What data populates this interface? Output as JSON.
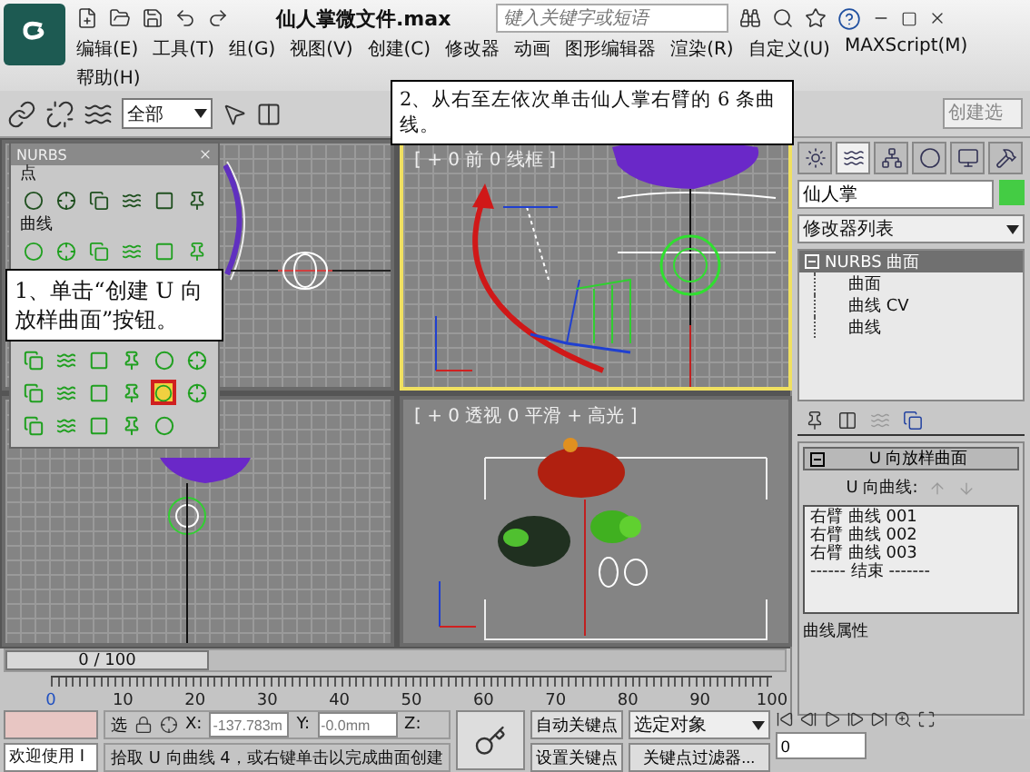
{
  "window": {
    "title": "仙人掌微文件.max",
    "search_placeholder": "键入关键字或短语"
  },
  "menu": [
    "编辑(E)",
    "工具(T)",
    "组(G)",
    "视图(V)",
    "创建(C)",
    "修改器",
    "动画",
    "图形编辑器",
    "渲染(R)",
    "自定义(U)",
    "MAXScript(M)",
    "帮助(H)"
  ],
  "toolbar": {
    "selection_filter": "全部",
    "named_selection": "创建选"
  },
  "callouts": [
    {
      "text": "1、单击“创建 U 向放样曲面”按钮。"
    },
    {
      "text": "2、从右至左依次单击仙人掌右臂的 6 条曲线。"
    }
  ],
  "nurbs_panel": {
    "title": "NURBS",
    "sections": [
      {
        "label": "点",
        "tools": [
          {
            "selected": false
          },
          {
            "selected": false
          },
          {
            "selected": false
          },
          {
            "selected": false
          },
          {
            "selected": false
          },
          {
            "selected": false
          }
        ]
      },
      {
        "label": "曲线",
        "tools": [
          {
            "selected": false
          },
          {
            "selected": false
          },
          {
            "selected": false
          },
          {
            "selected": false
          },
          {
            "selected": false
          },
          {
            "selected": false
          }
        ]
      }
    ],
    "surface_rows": [
      {
        "tools": [
          {
            "selected": false
          },
          {
            "selected": false
          },
          {
            "selected": false
          },
          {
            "selected": false
          },
          {
            "selected": false
          },
          {
            "selected": false
          }
        ]
      },
      {
        "tools": [
          {
            "selected": false
          },
          {
            "selected": false
          },
          {
            "selected": false
          },
          {
            "selected": false
          },
          {
            "selected": true
          },
          {
            "selected": false
          }
        ]
      },
      {
        "tools": [
          {
            "selected": false
          },
          {
            "selected": false
          },
          {
            "selected": false
          },
          {
            "selected": false
          },
          {
            "selected": false
          }
        ]
      }
    ]
  },
  "viewports": [
    {
      "kind": "front-partial",
      "active": false
    },
    {
      "kind": "front",
      "label": "[ + 0 前 0 线框 ]",
      "active": true
    },
    {
      "kind": "left-partial",
      "active": false
    },
    {
      "kind": "perspective",
      "label": "[ + 0 透视 0 平滑 + 高光 ]",
      "active": false
    }
  ],
  "command_panel": {
    "tabs": [
      {
        "selected": false
      },
      {
        "selected": true
      },
      {
        "selected": false
      },
      {
        "selected": false
      },
      {
        "selected": false
      },
      {
        "selected": false
      }
    ],
    "object": {
      "name": "仙人掌",
      "color": "#44cc44"
    },
    "modifier_list": "修改器列表",
    "stack": [
      {
        "label": "NURBS 曲面",
        "selected": true,
        "expanded": true,
        "children": [
          {
            "label": "曲面"
          },
          {
            "label": "曲线 CV"
          },
          {
            "label": "曲线"
          }
        ]
      }
    ],
    "rollout": {
      "title": "U 向放样曲面",
      "expanded": true,
      "curves_label": "U 向曲线:",
      "curves": [
        "右臂 曲线 001",
        "右臂 曲线 002",
        "右臂 曲线 003",
        "------ 结束 -------"
      ]
    },
    "group_label": "曲线属性"
  },
  "timeline": {
    "position": "0 / 100",
    "level": 0,
    "ticks": [
      "0",
      "10",
      "20",
      "30",
      "40",
      "50",
      "60",
      "70",
      "80",
      "90",
      "100"
    ]
  },
  "status": {
    "welcome": "欢迎使用 I",
    "lock_label": "选",
    "coords": [
      {
        "label": "X:",
        "value": "-137.783m"
      },
      {
        "label": "Y:",
        "value": "-0.0mm"
      },
      {
        "label": "Z:"
      }
    ],
    "auto_key": "自动关键点",
    "set_key": "设置关键点",
    "key_mode": "选定对象",
    "key_filters": "关键点过滤器...",
    "frame": "0",
    "prompt": "拾取 U 向曲线 4，或右键单击以完成曲面创建"
  }
}
